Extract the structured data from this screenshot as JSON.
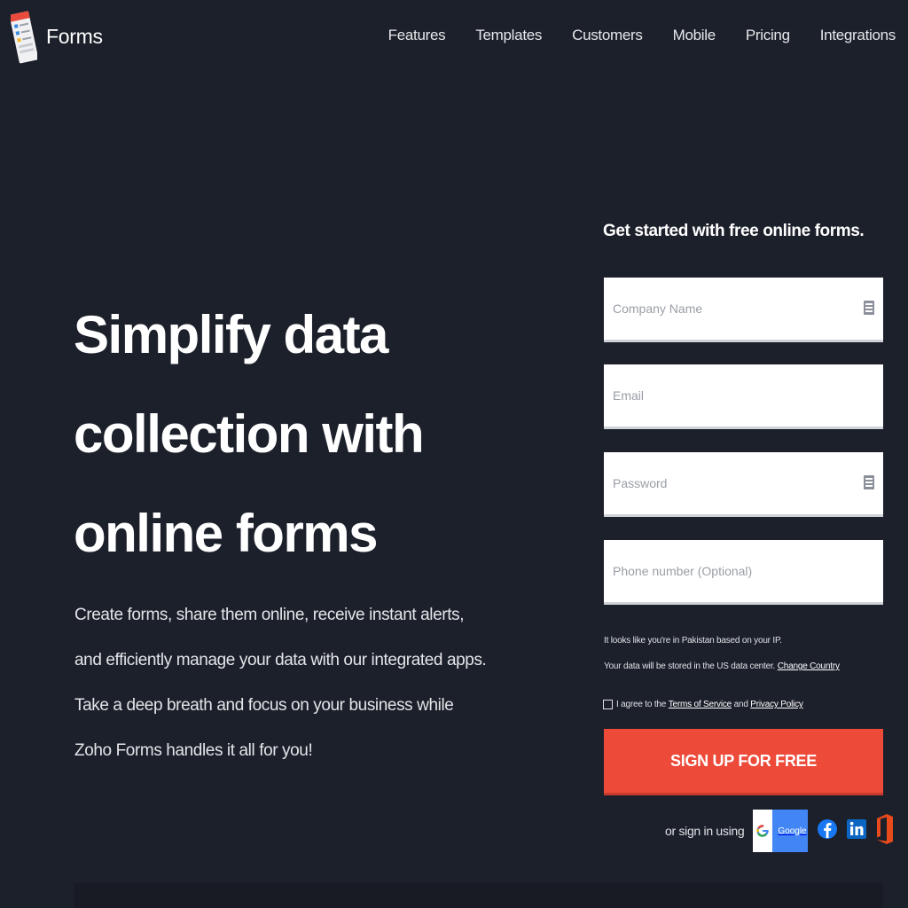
{
  "header": {
    "logo_text": "Forms",
    "nav": [
      "Features",
      "Templates",
      "Customers",
      "Mobile",
      "Pricing",
      "Integrations"
    ]
  },
  "hero": {
    "title_lines": [
      "Simplify data",
      "collection with",
      "online forms"
    ],
    "description": "Create forms, share them online, receive instant alerts, and efficiently manage your data with our integrated apps. Take a deep breath and focus on your business while Zoho Forms handles it all for you!"
  },
  "signup": {
    "title": "Get started with free online forms.",
    "company_placeholder": "Company Name",
    "email_placeholder": "Email",
    "password_placeholder": "Password",
    "phone_placeholder": "Phone number (Optional)",
    "notice_line1": "It looks like you're in Pakistan based on your IP.",
    "notice_line2_prefix": "Your data will be stored in the US data center.",
    "change_country_link": "Change Country",
    "agree_prefix": "I agree to the",
    "terms_link": "Terms of Service",
    "agree_and": "and",
    "privacy_link": "Privacy Policy",
    "signup_button": "SIGN UP FOR FREE",
    "social_label": "or sign in using",
    "google_label": "Google"
  },
  "icons": {
    "field_icon": "id-card-icon",
    "facebook": "facebook-icon",
    "linkedin": "linkedin-icon",
    "office": "office365-icon"
  },
  "colors": {
    "background": "#1c202b",
    "accent": "#ed4a3a",
    "google": "#4285f4",
    "facebook": "#1877f2",
    "linkedin": "#0a66c2",
    "office": "#e74a1b"
  }
}
